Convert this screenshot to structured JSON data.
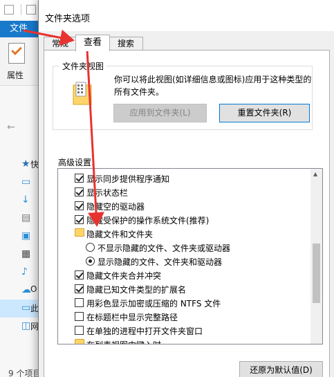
{
  "explorer": {
    "file_tab": "文件",
    "properties_label": "属性",
    "nav_arrows": "←  →",
    "nav_items": [
      {
        "label": "快",
        "icon": "pin-icon",
        "selected": false
      },
      {
        "label": "",
        "icon": "desktop-icon",
        "selected": false
      },
      {
        "label": "",
        "icon": "download-icon",
        "selected": false
      },
      {
        "label": "",
        "icon": "document-icon",
        "selected": false
      },
      {
        "label": "",
        "icon": "picture-icon",
        "selected": false
      },
      {
        "label": "",
        "icon": "video-icon",
        "selected": false
      },
      {
        "label": "",
        "icon": "music-icon",
        "selected": false
      },
      {
        "label": "O",
        "icon": "cloud-icon",
        "selected": false
      },
      {
        "label": "此",
        "icon": "pc-icon",
        "selected": true
      },
      {
        "label": "网",
        "icon": "network-icon",
        "selected": false
      }
    ],
    "status_text": "9 个项目"
  },
  "dialog": {
    "title": "文件夹选项",
    "tabs": [
      {
        "label": "常规",
        "active": false
      },
      {
        "label": "查看",
        "active": true
      },
      {
        "label": "搜索",
        "active": false
      }
    ],
    "folder_views": {
      "group_label": "文件夹视图",
      "description": "你可以将此视图(如详细信息或图标)应用于这种类型的所有文件夹。",
      "apply_button": "应用到文件夹(L)",
      "reset_button": "重置文件夹(R)"
    },
    "advanced": {
      "label": "高级设置:",
      "items": [
        {
          "kind": "checkbox",
          "checked": true,
          "label": "显示同步提供程序通知",
          "indent": 1
        },
        {
          "kind": "checkbox",
          "checked": true,
          "label": "显示状态栏",
          "indent": 1
        },
        {
          "kind": "checkbox",
          "checked": true,
          "label": "隐藏空的驱动器",
          "indent": 1
        },
        {
          "kind": "checkbox",
          "checked": true,
          "label": "隐藏受保护的操作系统文件(推荐)",
          "indent": 1
        },
        {
          "kind": "folder",
          "checked": false,
          "label": "隐藏文件和文件夹",
          "indent": 1
        },
        {
          "kind": "radio",
          "checked": false,
          "label": "不显示隐藏的文件、文件夹或驱动器",
          "indent": 2
        },
        {
          "kind": "radio",
          "checked": true,
          "label": "显示隐藏的文件、文件夹和驱动器",
          "indent": 2
        },
        {
          "kind": "checkbox",
          "checked": true,
          "label": "隐藏文件夹合并冲突",
          "indent": 1
        },
        {
          "kind": "checkbox",
          "checked": true,
          "label": "隐藏已知文件类型的扩展名",
          "indent": 1
        },
        {
          "kind": "checkbox",
          "checked": false,
          "label": "用彩色显示加密或压缩的 NTFS 文件",
          "indent": 1
        },
        {
          "kind": "checkbox",
          "checked": false,
          "label": "在标题栏中显示完整路径",
          "indent": 1
        },
        {
          "kind": "checkbox",
          "checked": false,
          "label": "在单独的进程中打开文件夹窗口",
          "indent": 1
        },
        {
          "kind": "folder",
          "checked": false,
          "label": "在列表视图中键入时",
          "indent": 1
        }
      ]
    },
    "restore_button": "还原为默认值(D)"
  },
  "colors": {
    "accent": "#1979ca",
    "annotation_arrow": "#e8322f",
    "selection": "#cce8ff"
  }
}
